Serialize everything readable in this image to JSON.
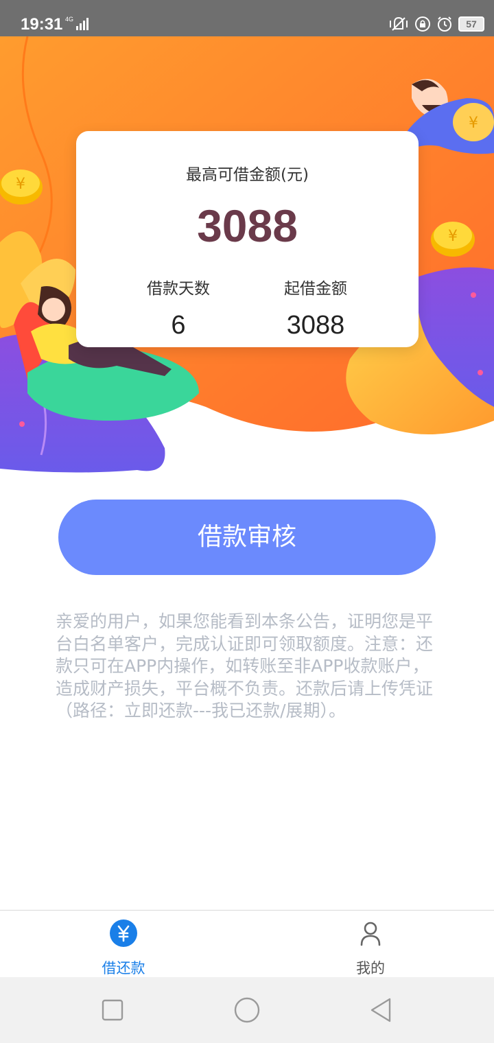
{
  "status_bar": {
    "time": "19:31",
    "network": "4G",
    "battery": "57"
  },
  "loan_card": {
    "max_amount_label": "最高可借金额(元)",
    "max_amount": "3088",
    "days_label": "借款天数",
    "days_value": "6",
    "min_amount_label": "起借金额",
    "min_amount_value": "3088"
  },
  "apply_button_label": "借款审核",
  "notice": "亲爱的用户，如果您能看到本条公告，证明您是平台白名单客户，完成认证即可领取额度。注意：还款只可在APP内操作，如转账至非APP收款账户，造成财产损失，平台概不负责。还款后请上传凭证（路径：立即还款---我已还款/展期）。",
  "tabs": [
    {
      "label": "借还款",
      "icon": "yuan-icon",
      "active": true
    },
    {
      "label": "我的",
      "icon": "person-icon",
      "active": false
    }
  ],
  "colors": {
    "accent": "#1a7fe8",
    "button": "#6b8afd",
    "amount": "#6a3a4a",
    "hero_orange": "#ff8a2a",
    "notice_text": "#b6bcc6"
  }
}
